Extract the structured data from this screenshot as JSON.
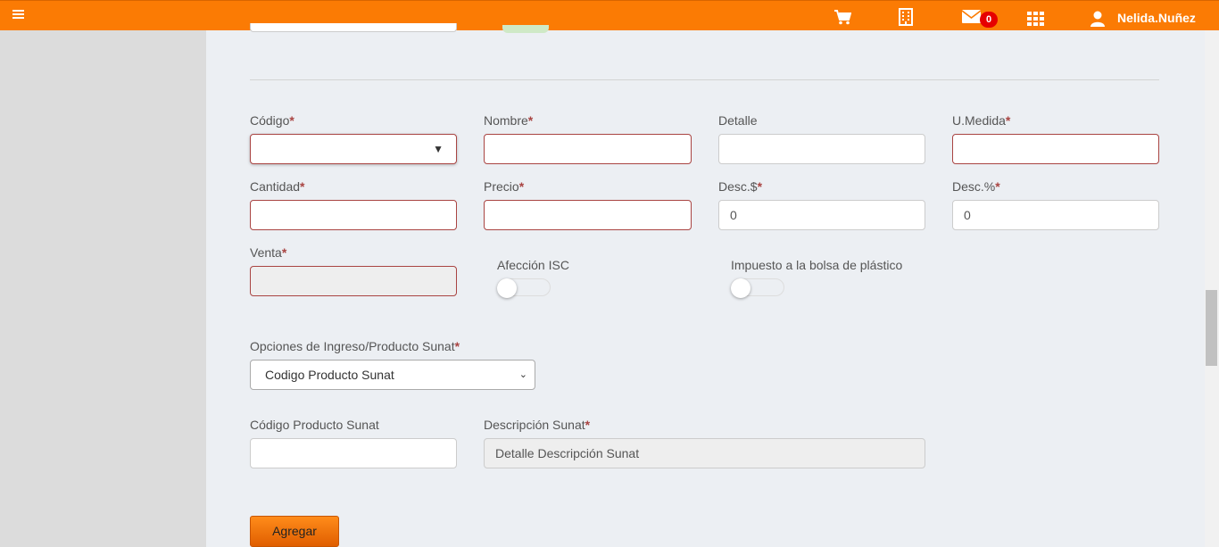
{
  "topbar": {
    "badge_count": "0",
    "user_name": "Nelida.Nuñez",
    "icons": [
      "menu-icon",
      "cart-icon",
      "building-icon",
      "envelope-icon",
      "grid-icon",
      "user-icon"
    ]
  },
  "form": {
    "codigo": {
      "label": "Código",
      "value": ""
    },
    "nombre": {
      "label": "Nombre",
      "value": ""
    },
    "detalle": {
      "label": "Detalle",
      "value": ""
    },
    "umedida": {
      "label": "U.Medida",
      "value": ""
    },
    "cantidad": {
      "label": "Cantidad",
      "value": ""
    },
    "precio": {
      "label": "Precio",
      "value": ""
    },
    "desc_monto": {
      "label": "Desc.$",
      "value": "0"
    },
    "desc_pct": {
      "label": "Desc.%",
      "value": "0"
    },
    "venta": {
      "label": "Venta",
      "value": ""
    },
    "afeccion_isc": {
      "label": "Afección ISC",
      "checked": false
    },
    "impuesto_bolsa": {
      "label": "Impuesto a la bolsa de plástico",
      "checked": false
    },
    "opciones_sunat": {
      "label": "Opciones de Ingreso/Producto Sunat",
      "selected": "Codigo Producto Sunat"
    },
    "codigo_sunat": {
      "label": "Código Producto Sunat",
      "value": ""
    },
    "descripcion_sunat": {
      "label": "Descripción Sunat",
      "placeholder": "Detalle Descripción Sunat"
    },
    "required_mark": "*",
    "add_button": "Agregar"
  },
  "colors": {
    "topbar": "#fb7b04",
    "error_border": "#a94442",
    "badge": "#e60000",
    "sidebar": "#dcdcdc",
    "content": "#eceff3"
  }
}
